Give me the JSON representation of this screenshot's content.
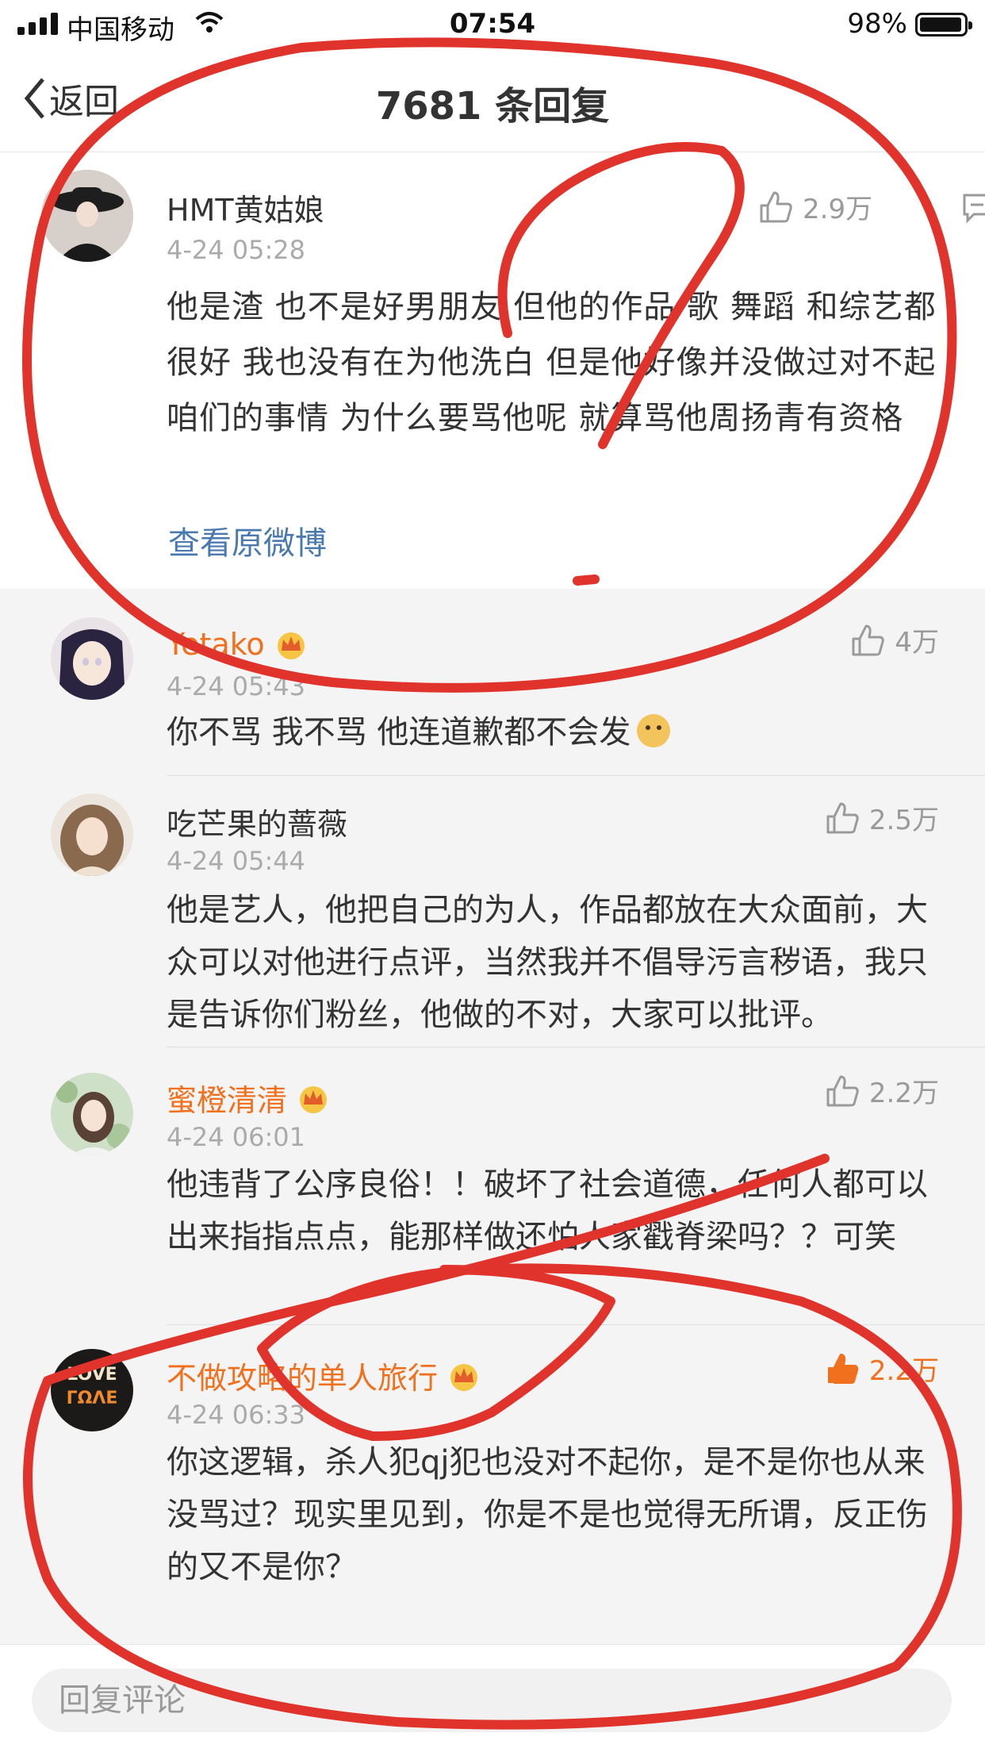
{
  "status_bar": {
    "carrier": "中国移动",
    "time": "07:54",
    "battery_percent": "98%",
    "battery_level": 0.98
  },
  "nav": {
    "back_label": "返回",
    "title": "7681 条回复"
  },
  "main_post": {
    "username": "HMT黄姑娘",
    "time": "4-24 05:28",
    "likes": "2.9万",
    "text": "他是渣 也不是好男朋友 但他的作品 歌 舞蹈 和综艺都很好 我也没有在为他洗白 但是他好像并没做过对不起咱们的事情 为什么要骂他呢 就算骂他周扬青有资格",
    "view_original_label": "查看原微博"
  },
  "replies": [
    {
      "username": "Yetako",
      "vip": true,
      "time": "4-24 05:43",
      "likes": "4万",
      "text": "你不骂 我不骂 他连道歉都不会发",
      "liked": false
    },
    {
      "username": "吃芒果的蔷薇",
      "vip": false,
      "time": "4-24 05:44",
      "likes": "2.5万",
      "text": "他是艺人，他把自己的为人，作品都放在大众面前，大众可以对他进行点评，当然我并不倡导污言秽语，我只是告诉你们粉丝，他做的不对，大家可以批评。",
      "liked": false
    },
    {
      "username": "蜜橙清清",
      "vip": true,
      "time": "4-24 06:01",
      "likes": "2.2万",
      "text": "他违背了公序良俗！！破坏了社会道德，任何人都可以出来指指点点，能那样做还怕人家戳脊梁吗？？可笑",
      "liked": false
    },
    {
      "username": "不做攻略的单人旅行",
      "vip": true,
      "time": "4-24 06:33",
      "likes": "2.2万",
      "text": "你这逻辑，杀人犯qj犯也没对不起你，是不是你也从来没骂过？现实里见到，你是不是也觉得无所谓，反正伤的又不是你？",
      "liked": true,
      "avatar_text_top": "LOVE",
      "avatar_text_bottom": "ГΩΛΕ"
    }
  ],
  "bottom_bar": {
    "reply_placeholder": "回复评论"
  },
  "colors": {
    "vip_name": "#f0701e",
    "link": "#4a79b0",
    "annotation": "#e0332b"
  }
}
